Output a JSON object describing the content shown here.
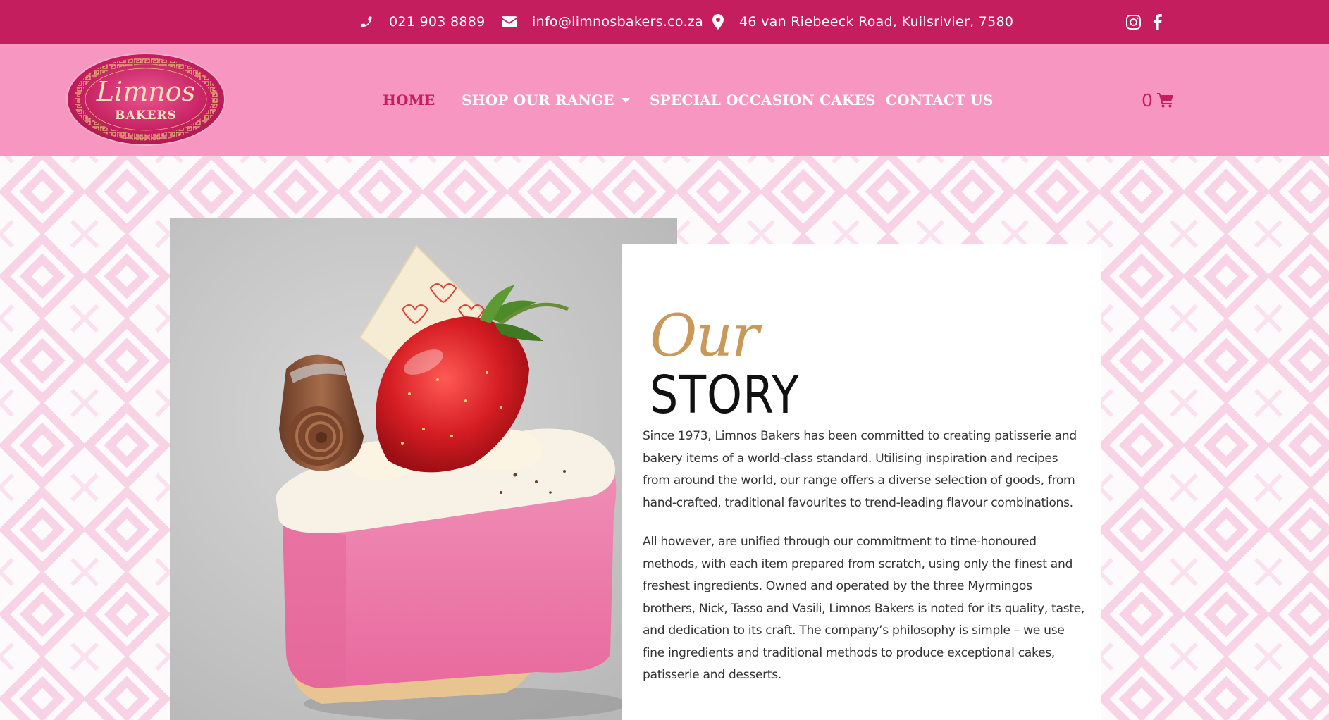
{
  "topbar": {
    "phone": "021 903 8889",
    "email": "info@limnosbakers.co.za",
    "address": "46 van Riebeeck Road, Kuilsrivier, 7580",
    "social": [
      "instagram-icon",
      "facebook-icon"
    ]
  },
  "logo": {
    "name": "Limnos",
    "subtitle": "BAKERS"
  },
  "nav": {
    "items": [
      {
        "label": "HOME",
        "active": true
      },
      {
        "label": "SHOP OUR RANGE",
        "dropdown": true
      },
      {
        "label": "SPECIAL OCCASION CAKES"
      },
      {
        "label": "CONTACT US"
      }
    ],
    "cart_count": "0"
  },
  "story": {
    "heading_script": "Our",
    "heading_main": "STORY",
    "paragraph1": "Since 1973, Limnos Bakers has been committed to creating patisserie and bakery items of a world-class standard. Utilising inspiration and recipes from around the world, our range offers a diverse selection of goods, from hand-crafted, traditional favourites to trend-leading flavour combinations.",
    "paragraph2": "All however, are unified through our commitment to time-honoured methods, with each item prepared from scratch, using only the finest and freshest ingredients. Owned and operated by the three Myrmingos brothers, Nick, Tasso and Vasili, Limnos Bakers is noted for its quality, taste, and dedication to its craft. The company’s philosophy is simple – we use fine ingredients and traditional methods to produce exceptional cakes, patisserie and desserts."
  },
  "colors": {
    "brand_dark": "#c41e5f",
    "brand_light": "#f797c1",
    "gold": "#c9995a"
  }
}
